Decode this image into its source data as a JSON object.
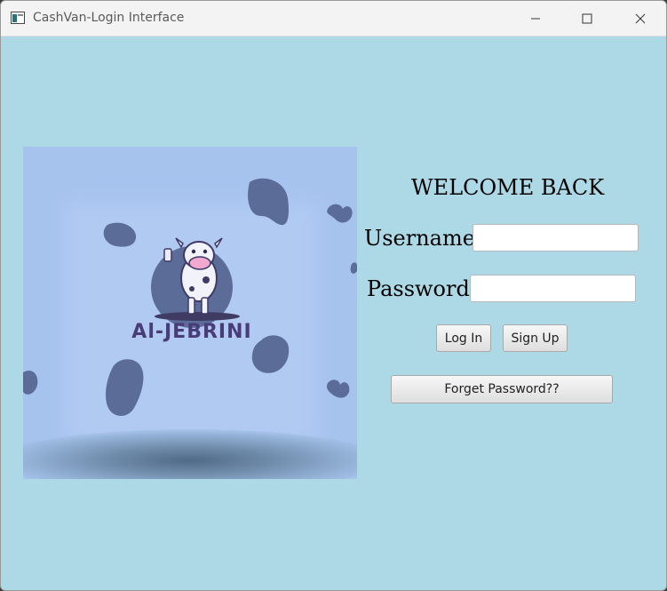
{
  "window": {
    "title": "CashVan-Login Interface",
    "background": "#add8e6"
  },
  "logo": {
    "brand_text": "Al-JEBRINI"
  },
  "form": {
    "heading": "WELCOME BACK",
    "username_label": "Username:",
    "username_value": "",
    "password_label": "Password:",
    "password_value": "",
    "login_label": "Log In",
    "signup_label": "Sign Up",
    "forget_label": "Forget Password??"
  },
  "icons": {
    "app": "app-window-icon",
    "minimize": "minimize-icon",
    "maximize": "maximize-icon",
    "close": "close-icon"
  }
}
